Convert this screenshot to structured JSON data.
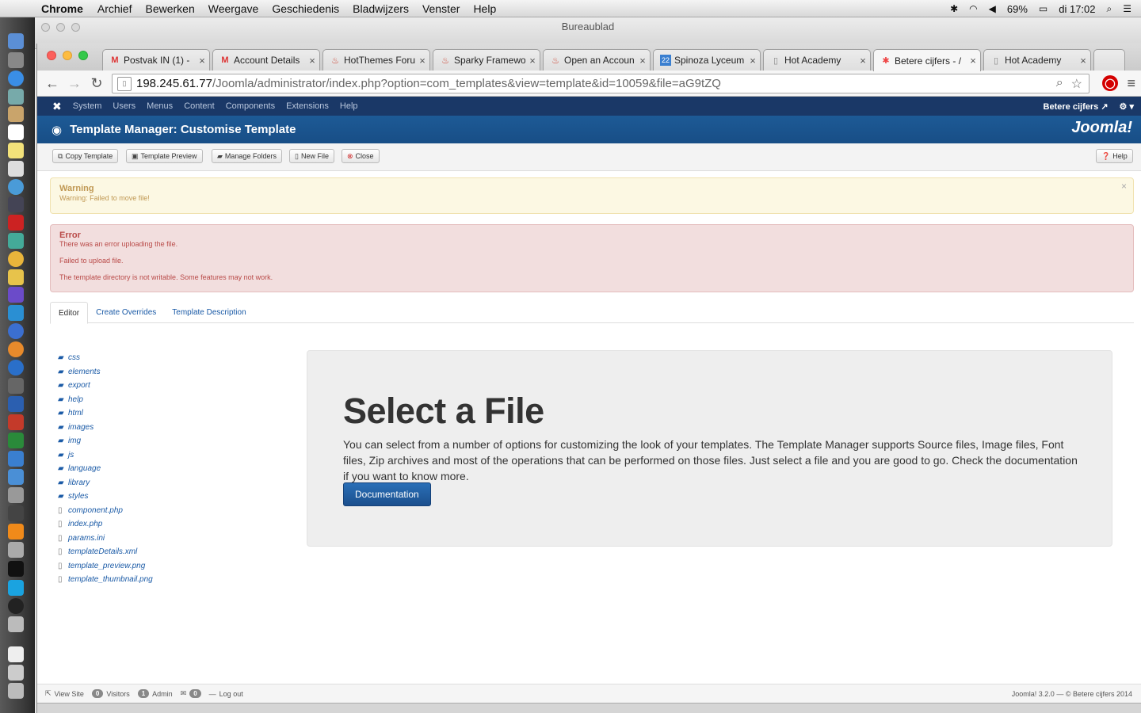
{
  "menubar": {
    "app_name": "Chrome",
    "items": [
      "Archief",
      "Bewerken",
      "Weergave",
      "Geschiedenis",
      "Bladwijzers",
      "Venster",
      "Help"
    ],
    "battery": "69%",
    "clock": "di 17:02"
  },
  "background_window": {
    "title": "Bureaublad"
  },
  "browser": {
    "tabs": [
      {
        "label": "Postvak IN (1) -",
        "favicon": "gmail-icon"
      },
      {
        "label": "Account Details",
        "favicon": "gmail-icon"
      },
      {
        "label": "HotThemes Foru",
        "favicon": "flame-icon"
      },
      {
        "label": "Sparky Framewo",
        "favicon": "flame-icon"
      },
      {
        "label": "Open an Accoun",
        "favicon": "flame-icon"
      },
      {
        "label": "Spinoza Lyceum",
        "favicon": "calendar-icon"
      },
      {
        "label": "Hot Academy",
        "favicon": "page-icon"
      },
      {
        "label": "Betere cijfers - /",
        "favicon": "joomla-icon"
      },
      {
        "label": "Hot Academy",
        "favicon": "page-icon"
      }
    ],
    "active_tab": 7,
    "url_host": "198.245.61.77",
    "url_path": "/Joomla/administrator/index.php?option=com_templates&view=template&id=10059&file=aG9tZQ"
  },
  "joomla": {
    "topnav": [
      "System",
      "Users",
      "Menus",
      "Content",
      "Components",
      "Extensions",
      "Help"
    ],
    "site_name": "Betere cijfers",
    "page_title": "Template Manager: Customise Template",
    "brand": "Joomla!",
    "toolbar": {
      "copy_template": "Copy Template",
      "template_preview": "Template Preview",
      "manage_folders": "Manage Folders",
      "new_file": "New File",
      "close": "Close",
      "help": "Help"
    },
    "warning": {
      "heading": "Warning",
      "message": "Warning: Failed to move file!"
    },
    "error": {
      "heading": "Error",
      "messages": [
        "There was an error uploading the file.",
        "Failed to upload file.",
        "The template directory is not writable. Some features may not work."
      ]
    },
    "tabs": [
      "Editor",
      "Create Overrides",
      "Template Description"
    ],
    "tree": {
      "folders": [
        "css",
        "elements",
        "export",
        "help",
        "html",
        "images",
        "img",
        "js",
        "language",
        "library",
        "styles"
      ],
      "files": [
        "component.php",
        "index.php",
        "params.ini",
        "templateDetails.xml",
        "template_preview.png",
        "template_thumbnail.png"
      ]
    },
    "select_file": {
      "heading": "Select a File",
      "description": "You can select from a number of options for customizing the look of your templates. The Template Manager supports Source files, Image files, Font files, Zip archives and most of the operations that can be performed on those files. Just select a file and you are good to go. Check the documentation if you want to know more.",
      "button": "Documentation"
    },
    "status": {
      "view_site": "View Site",
      "visitors_count": "0",
      "visitors": "Visitors",
      "admin_count": "1",
      "admin": "Admin",
      "messages_count": "0",
      "logout": "Log out",
      "version": "Joomla! 3.2.0 — © Betere cijfers 2014"
    }
  }
}
